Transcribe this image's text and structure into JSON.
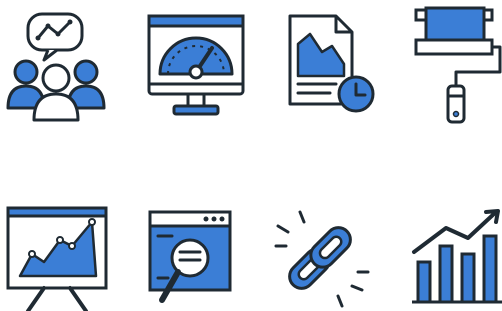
{
  "colors": {
    "accent": "#3b7ed6",
    "outline": "#1f2a33",
    "background": "#ffffff",
    "light": "#e8f0fb"
  },
  "icons": [
    "team-discussion-analytics-icon",
    "speedometer-monitor-icon",
    "document-chart-clock-icon",
    "paint-roller-icon",
    "presentation-board-chart-icon",
    "browser-search-magnifier-icon",
    "broken-chain-link-icon",
    "growth-bar-chart-icon"
  ]
}
